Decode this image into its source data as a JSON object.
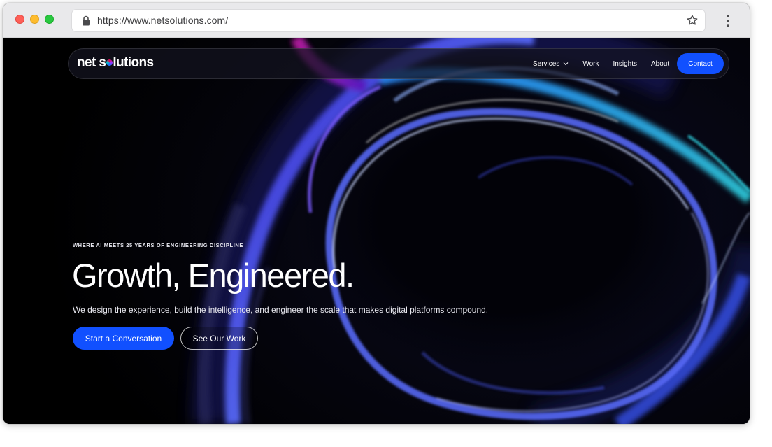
{
  "browser": {
    "url": "https://www.netsolutions.com/",
    "icons": [
      "lock-icon",
      "star-icon",
      "kebab-menu-icon"
    ]
  },
  "site": {
    "logo": {
      "part1": "net s",
      "part2": "lutions"
    },
    "nav": {
      "services": "Services",
      "work": "Work",
      "insights": "Insights",
      "about": "About",
      "contact": "Contact"
    }
  },
  "hero": {
    "eyebrow": "WHERE AI MEETS 25 YEARS OF ENGINEERING DISCIPLINE",
    "headline": "Growth, Engineered.",
    "subhead": "We design the experience, build the intelligence, and engineer the scale that makes digital platforms compound.",
    "cta_primary": "Start a Conversation",
    "cta_secondary": "See Our Work"
  },
  "colors": {
    "accent": "#1150ff",
    "background": "#000000"
  }
}
